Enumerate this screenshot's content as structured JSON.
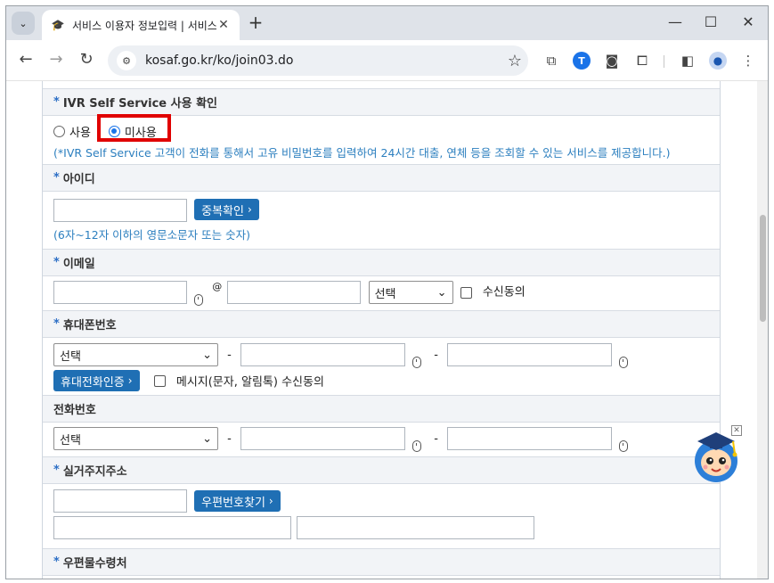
{
  "browser": {
    "tab_title": "서비스 이용자 정보입력 | 서비스 이용",
    "url": "kosaf.go.kr/ko/join03.do",
    "new_tab": "+",
    "minimize": "—",
    "maximize": "☐",
    "close": "✕"
  },
  "ivr": {
    "title": "IVR Self Service 사용 확인",
    "option_use": "사용",
    "option_nouse": "미사용",
    "selected": "미사용",
    "note": "(*IVR Self Service 고객이 전화를 통해서 고유 비밀번호를 입력하여 24시간 대출, 연체 등을 조회할 수 있는 서비스를 제공합니다.)"
  },
  "id": {
    "title": "아이디",
    "check_button": "중복확인",
    "note": "(6자~12자 이하의 영문소문자 또는 숫자)"
  },
  "email": {
    "title": "이메일",
    "at": "@",
    "domain_select": "선택",
    "consent": "수신동의"
  },
  "mobile": {
    "title": "휴대폰번호",
    "carrier_select": "선택",
    "verify_button": "휴대전화인증",
    "consent": "메시지(문자, 알림톡) 수신동의",
    "dash": "-"
  },
  "phone": {
    "title": "전화번호",
    "area_select": "선택",
    "dash": "-"
  },
  "address": {
    "title": "실거주지주소",
    "find_button": "우편번호찾기"
  },
  "mail_receive": {
    "title": "우편물수령처"
  },
  "required_mark": "*",
  "chevron": "›"
}
